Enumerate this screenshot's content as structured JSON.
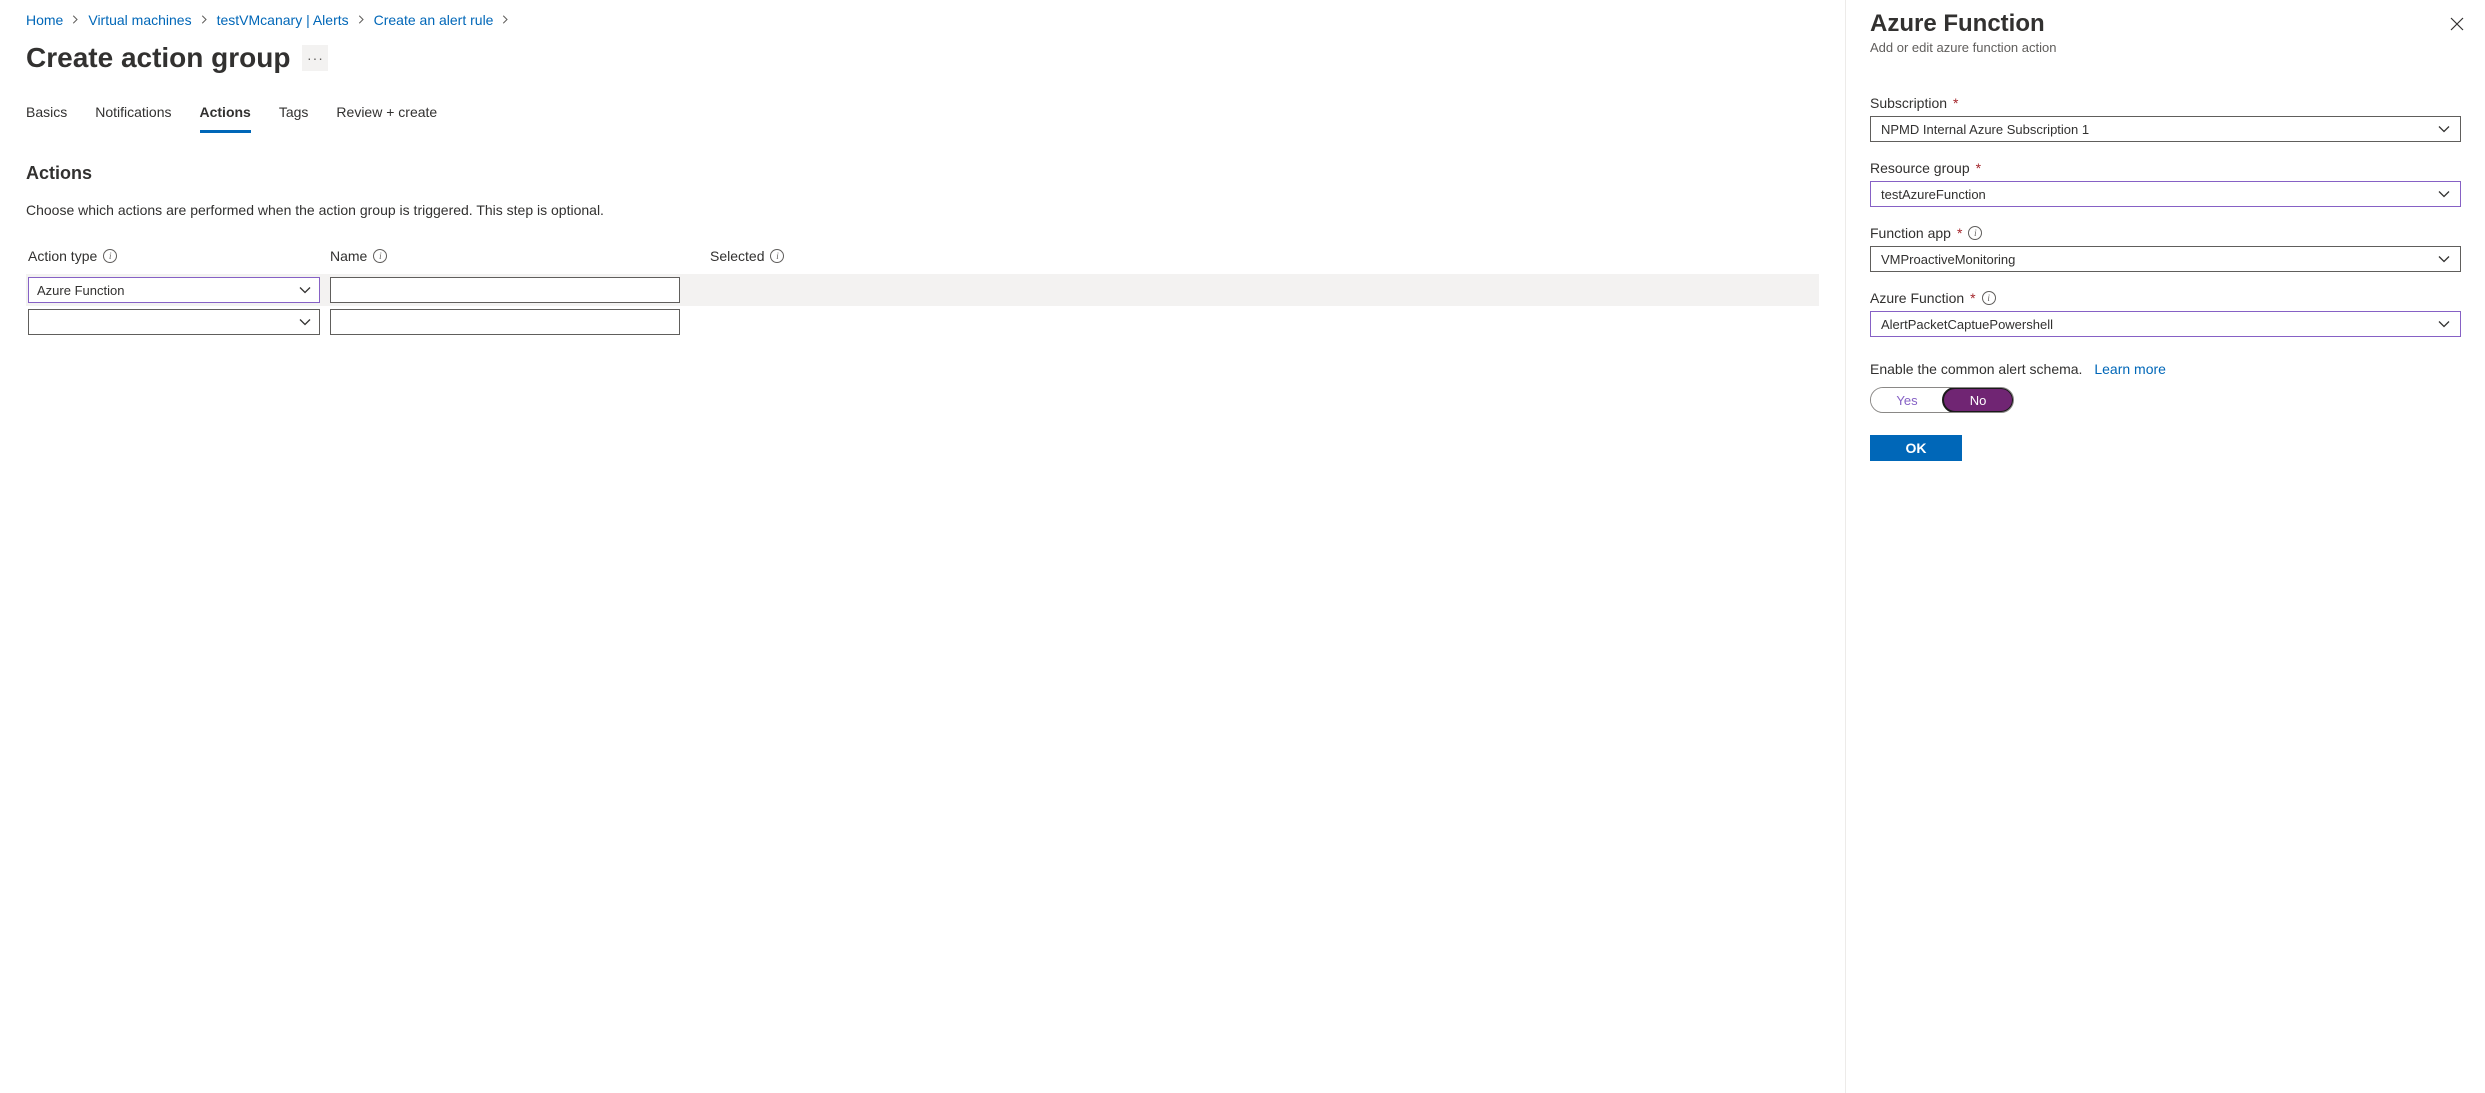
{
  "breadcrumb": [
    {
      "label": "Home"
    },
    {
      "label": "Virtual machines"
    },
    {
      "label": "testVMcanary | Alerts"
    },
    {
      "label": "Create an alert rule"
    }
  ],
  "page_title": "Create action group",
  "more_label": "···",
  "tabs": [
    {
      "label": "Basics",
      "active": false
    },
    {
      "label": "Notifications",
      "active": false
    },
    {
      "label": "Actions",
      "active": true
    },
    {
      "label": "Tags",
      "active": false
    },
    {
      "label": "Review + create",
      "active": false
    }
  ],
  "section_title": "Actions",
  "section_desc": "Choose which actions are performed when the action group is triggered. This step is optional.",
  "table": {
    "headers": {
      "type": "Action type",
      "name": "Name",
      "selected": "Selected"
    },
    "rows": [
      {
        "type": "Azure Function",
        "name": "",
        "highlight": true,
        "active": true
      },
      {
        "type": "",
        "name": "",
        "highlight": false,
        "active": false
      }
    ]
  },
  "panel": {
    "title": "Azure Function",
    "subtitle": "Add or edit azure function action",
    "fields": {
      "subscription": {
        "label": "Subscription",
        "value": "NPMD Internal Azure Subscription 1",
        "required": true,
        "info": false,
        "focus": false
      },
      "resource_group": {
        "label": "Resource group",
        "value": "testAzureFunction",
        "required": true,
        "info": false,
        "focus": true
      },
      "function_app": {
        "label": "Function app",
        "value": "VMProactiveMonitoring",
        "required": true,
        "info": true,
        "focus": false
      },
      "azure_function": {
        "label": "Azure Function",
        "value": "AlertPacketCaptuePowershell",
        "required": true,
        "info": true,
        "focus": true
      }
    },
    "schema_text": "Enable the common alert schema.",
    "schema_link": "Learn more",
    "toggle": {
      "yes": "Yes",
      "no": "No",
      "value": "No"
    },
    "ok": "OK"
  }
}
